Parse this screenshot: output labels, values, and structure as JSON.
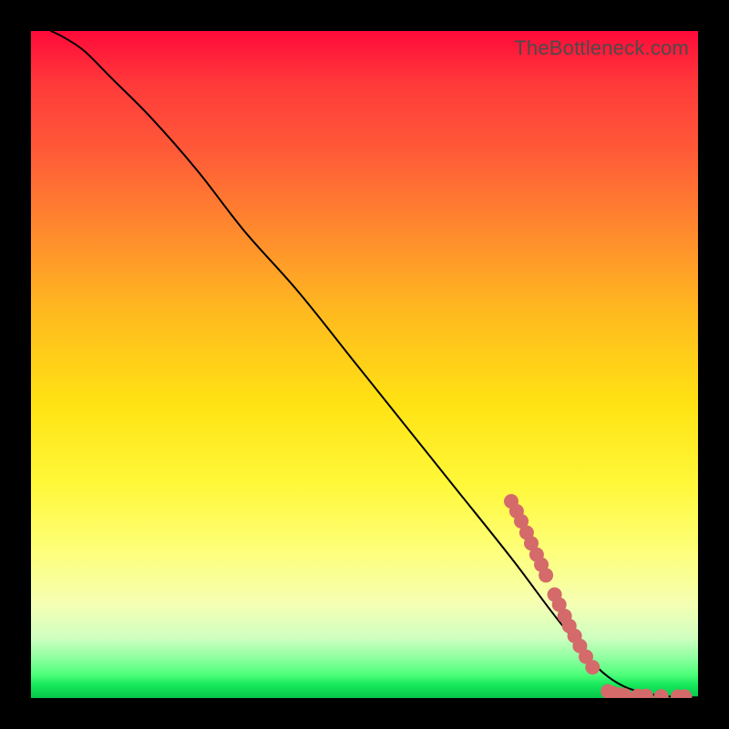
{
  "attribution": "TheBottleneck.com",
  "colors": {
    "curve": "#000000",
    "marker": "#d46a6a",
    "gradient_top": "#ff0a3a",
    "gradient_bottom": "#06c64a",
    "page_bg": "#000000"
  },
  "chart_data": {
    "type": "line",
    "title": "",
    "xlabel": "",
    "ylabel": "",
    "xlim": [
      0,
      100
    ],
    "ylim": [
      0,
      100
    ],
    "grid": false,
    "legend": false,
    "note": "Axes are unlabeled in source image; values are normalized 0–100. Curve descends from top-left toward bottom-right then flattens near y≈0 for x≥~85.",
    "series": [
      {
        "name": "curve",
        "x": [
          3,
          5,
          8,
          12,
          18,
          25,
          32,
          40,
          48,
          56,
          64,
          72,
          78,
          82,
          85,
          88,
          91,
          94,
          97,
          100
        ],
        "y": [
          100,
          99,
          97,
          93,
          87,
          79,
          70,
          61,
          51,
          41,
          31,
          21,
          13,
          8,
          4.5,
          2.2,
          1.0,
          0.4,
          0.15,
          0.1
        ]
      }
    ],
    "markers": {
      "name": "highlighted-points",
      "note": "Salmon circular markers clustered on lower-right of curve; estimated positions.",
      "points": [
        {
          "x": 72.0,
          "y": 29.5
        },
        {
          "x": 72.8,
          "y": 28.0
        },
        {
          "x": 73.5,
          "y": 26.5
        },
        {
          "x": 74.3,
          "y": 24.8
        },
        {
          "x": 75.0,
          "y": 23.2
        },
        {
          "x": 75.8,
          "y": 21.5
        },
        {
          "x": 76.5,
          "y": 20.0
        },
        {
          "x": 77.2,
          "y": 18.4
        },
        {
          "x": 78.5,
          "y": 15.5
        },
        {
          "x": 79.2,
          "y": 14.0
        },
        {
          "x": 80.0,
          "y": 12.3
        },
        {
          "x": 80.7,
          "y": 10.8
        },
        {
          "x": 81.5,
          "y": 9.3
        },
        {
          "x": 82.3,
          "y": 7.8
        },
        {
          "x": 83.2,
          "y": 6.2
        },
        {
          "x": 84.2,
          "y": 4.6
        },
        {
          "x": 86.5,
          "y": 1.0
        },
        {
          "x": 87.3,
          "y": 0.7
        },
        {
          "x": 88.2,
          "y": 0.5
        },
        {
          "x": 89.0,
          "y": 0.4
        },
        {
          "x": 91.0,
          "y": 0.3
        },
        {
          "x": 92.2,
          "y": 0.3
        },
        {
          "x": 94.5,
          "y": 0.25
        },
        {
          "x": 97.0,
          "y": 0.2
        },
        {
          "x": 98.0,
          "y": 0.2
        }
      ]
    }
  }
}
